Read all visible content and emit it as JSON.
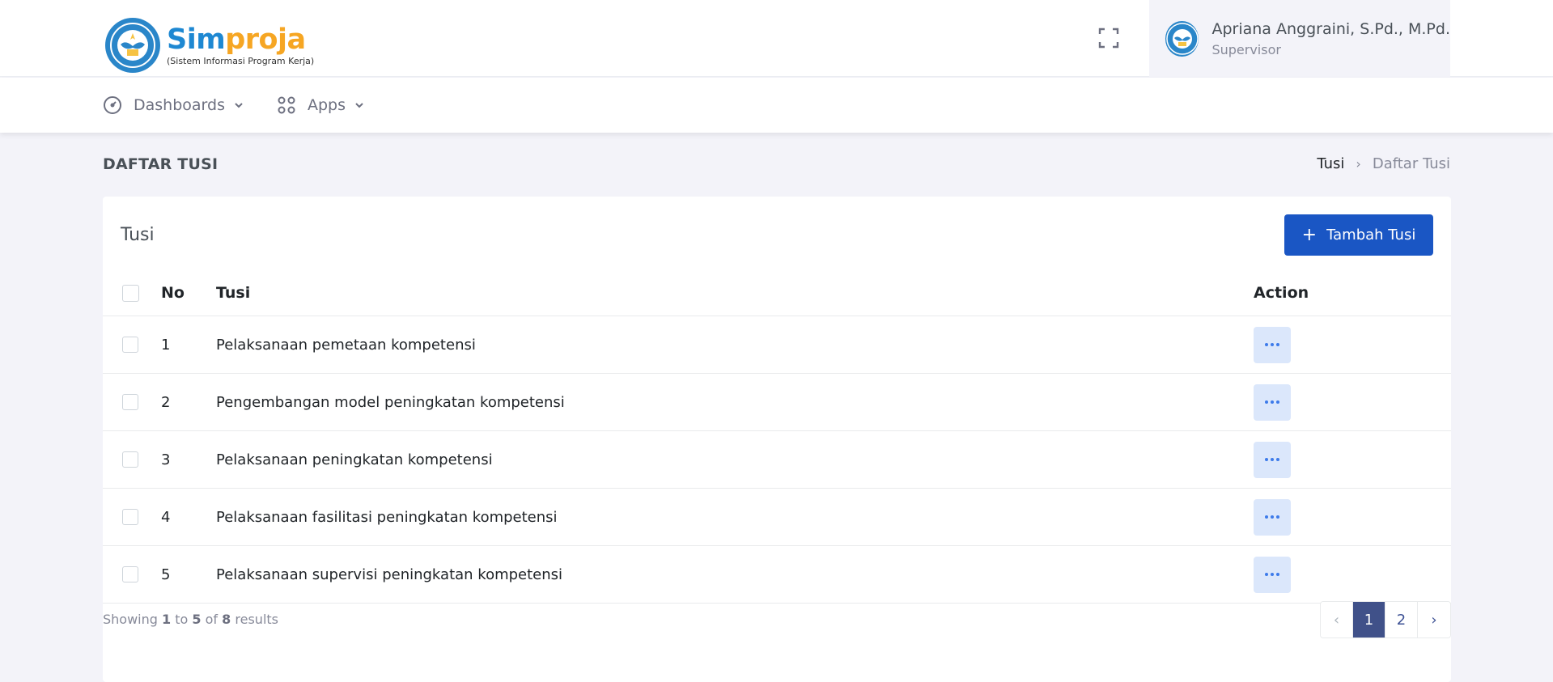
{
  "header": {
    "logo_part1": "Sim",
    "logo_part2": "proja",
    "logo_subtitle": "(Sistem Informasi Program Kerja)",
    "user_name": "Apriana Anggraini, S.Pd., M.Pd.",
    "user_role": "Supervisor"
  },
  "nav": {
    "items": [
      {
        "label": "Dashboards",
        "icon": "gauge-icon"
      },
      {
        "label": "Apps",
        "icon": "grid-icon"
      }
    ]
  },
  "page": {
    "title": "DAFTAR TUSI",
    "breadcrumb": [
      "Tusi",
      "Daftar Tusi"
    ]
  },
  "card": {
    "title": "Tusi",
    "add_button": "Tambah Tusi",
    "columns": [
      "No",
      "Tusi",
      "Action"
    ],
    "rows": [
      {
        "no": "1",
        "tusi": "Pelaksanaan pemetaan kompetensi"
      },
      {
        "no": "2",
        "tusi": "Pengembangan model peningkatan kompetensi"
      },
      {
        "no": "3",
        "tusi": "Pelaksanaan peningkatan kompetensi"
      },
      {
        "no": "4",
        "tusi": "Pelaksanaan fasilitasi peningkatan kompetensi"
      },
      {
        "no": "5",
        "tusi": "Pelaksanaan supervisi peningkatan kompetensi"
      }
    ],
    "showing": {
      "prefix": "Showing",
      "from": "1",
      "to_word": "to",
      "to": "5",
      "of_word": "of",
      "total": "8",
      "suffix": "results"
    },
    "pagination": {
      "prev": "‹",
      "pages": [
        "1",
        "2"
      ],
      "next": "›",
      "active": "1"
    }
  },
  "colors": {
    "primary": "#1a56c4",
    "pagination_active": "#405189",
    "logo_blue": "#1e88d2",
    "logo_orange": "#f6a623"
  }
}
